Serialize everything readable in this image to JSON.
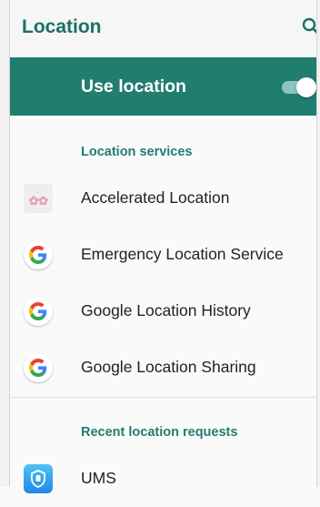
{
  "appbar": {
    "title": "Location",
    "search_icon": "search-icon"
  },
  "master_switch": {
    "label": "Use location",
    "enabled": true
  },
  "location_services": {
    "header": "Location services",
    "items": [
      {
        "label": "Accelerated Location",
        "icon": "accelerated-location-app-icon"
      },
      {
        "label": "Emergency Location Service",
        "icon": "google-g-icon"
      },
      {
        "label": "Google Location History",
        "icon": "google-g-icon"
      },
      {
        "label": "Google Location Sharing",
        "icon": "google-g-icon"
      }
    ]
  },
  "recent_requests": {
    "header": "Recent location requests",
    "items": [
      {
        "label": "UMS",
        "icon": "ums-app-icon"
      }
    ]
  },
  "colors": {
    "accent": "#217d70",
    "title": "#1c6f66",
    "background": "#fafafa"
  }
}
